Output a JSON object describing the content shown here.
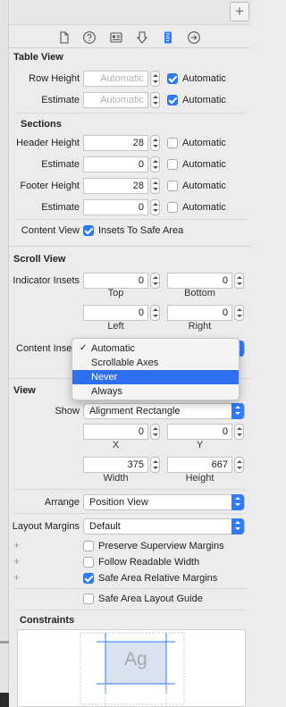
{
  "colors": {
    "accent": "#2f7cf6",
    "selection": "#2e6ff2",
    "panel": "#ececec"
  },
  "toolbar": {
    "add_button": "+",
    "icons": [
      "file-inspector-icon",
      "quick-help-icon",
      "identity-inspector-icon",
      "attributes-inspector-icon",
      "size-inspector-icon",
      "connections-inspector-icon"
    ]
  },
  "table_view": {
    "header": "Table View",
    "row_height": {
      "label": "Row Height",
      "placeholder": "Automatic",
      "checkbox_label": "Automatic",
      "checked": true
    },
    "estimate": {
      "label": "Estimate",
      "placeholder": "Automatic",
      "checkbox_label": "Automatic",
      "checked": true
    }
  },
  "sections": {
    "header": "Sections",
    "rows": [
      {
        "label": "Header Height",
        "value": "28",
        "checkbox_label": "Automatic",
        "checked": false
      },
      {
        "label": "Estimate",
        "value": "0",
        "checkbox_label": "Automatic",
        "checked": false
      },
      {
        "label": "Footer Height",
        "value": "28",
        "checkbox_label": "Automatic",
        "checked": false
      },
      {
        "label": "Estimate",
        "value": "0",
        "checkbox_label": "Automatic",
        "checked": false
      }
    ],
    "content_view": {
      "label": "Content View",
      "checkbox_label": "Insets To Safe Area",
      "checked": true
    }
  },
  "scroll_view": {
    "header": "Scroll View",
    "indicator_insets": {
      "label": "Indicator Insets",
      "top": "0",
      "bottom": "0",
      "left": "0",
      "right": "0",
      "top_caption": "Top",
      "bottom_caption": "Bottom",
      "left_caption": "Left",
      "right_caption": "Right"
    },
    "content_insets_label": "Content Inse",
    "menu": {
      "items": [
        "Automatic",
        "Scrollable Axes",
        "Never",
        "Always"
      ],
      "checked_item": "Automatic",
      "highlighted_item": "Never",
      "check_mark": "✓"
    }
  },
  "view": {
    "header": "View",
    "show": {
      "label": "Show",
      "value": "Alignment Rectangle"
    },
    "x": "0",
    "y": "0",
    "x_caption": "X",
    "y_caption": "Y",
    "width": "375",
    "height": "667",
    "width_caption": "Width",
    "height_caption": "Height",
    "arrange": {
      "label": "Arrange",
      "value": "Position View"
    },
    "layout_margins": {
      "label": "Layout Margins",
      "value": "Default"
    },
    "options": [
      {
        "label": "Preserve Superview Margins",
        "checked": false
      },
      {
        "label": "Follow Readable Width",
        "checked": false
      },
      {
        "label": "Safe Area Relative Margins",
        "checked": true
      }
    ],
    "safe_area_guide": {
      "label": "Safe Area Layout Guide",
      "checked": false
    },
    "plus_symbol": "+"
  },
  "constraints": {
    "header": "Constraints",
    "preview_text": "Ag"
  }
}
